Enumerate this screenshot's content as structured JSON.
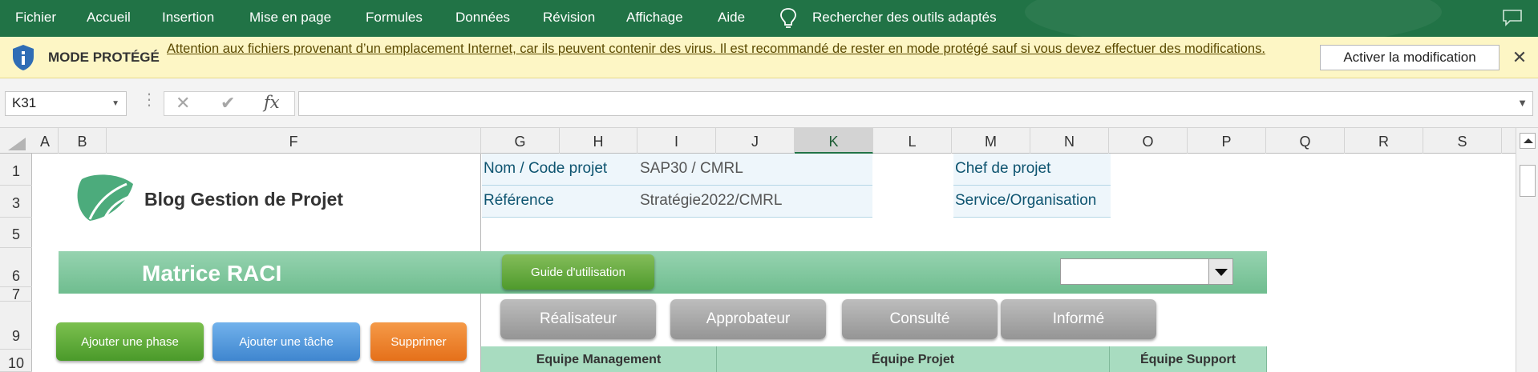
{
  "ribbon": {
    "tabs": [
      "Fichier",
      "Accueil",
      "Insertion",
      "Mise en page",
      "Formules",
      "Données",
      "Révision",
      "Affichage",
      "Aide"
    ],
    "search": "Rechercher des outils adaptés",
    "search_icon": "lightbulb-icon",
    "comment_icon": "comment-icon"
  },
  "protected_view": {
    "icon": "shield-icon",
    "title": "MODE PROTÉGÉ",
    "message": "Attention aux fichiers provenant d’un emplacement Internet, car ils peuvent contenir des virus. Il est recommandé de rester en mode protégé sauf si vous devez effectuer des modifications.",
    "enable_button": "Activer la modification",
    "close": "✕"
  },
  "formula_bar": {
    "name_box": "K31",
    "cancel": "✕",
    "confirm": "✔",
    "fx": "fx",
    "formula": ""
  },
  "columns": [
    "A",
    "B",
    "F",
    "G",
    "H",
    "I",
    "J",
    "K",
    "L",
    "M",
    "N",
    "O",
    "P",
    "Q",
    "R",
    "S"
  ],
  "rows": [
    "1",
    "3",
    "5",
    "6",
    "7",
    "9",
    "10"
  ],
  "selected_column": "K",
  "sheet": {
    "logo_text": "Blog Gestion de Projet",
    "project_code_label": "Nom / Code projet",
    "project_code_value": "SAP30 / CMRL",
    "reference_label": "Référence",
    "reference_value": "Stratégie2022/CMRL",
    "manager_label": "Chef de projet",
    "organisation_label": "Service/Organisation",
    "band_title": "Matrice RACI",
    "guide_button": "Guide d'utilisation",
    "dropdown_value": "",
    "raci_buttons": [
      "Réalisateur",
      "Approbateur",
      "Consulté",
      "Informé"
    ],
    "add_phase": "Ajouter une phase",
    "add_task": "Ajouter une tâche",
    "delete": "Supprimer",
    "teams": [
      "Equipe Management",
      "Équipe Projet",
      "Équipe Support"
    ]
  },
  "colors": {
    "ribbon": "#217346",
    "protected_bar": "#fdf6c5",
    "band": "#7cc69a",
    "guide_button": "#5fa83a",
    "add_phase": "#5ea83b",
    "add_task": "#4f95d9",
    "delete": "#ee7b22",
    "raci_button": "#a6a6a6",
    "team_header": "#a8dcc0"
  }
}
